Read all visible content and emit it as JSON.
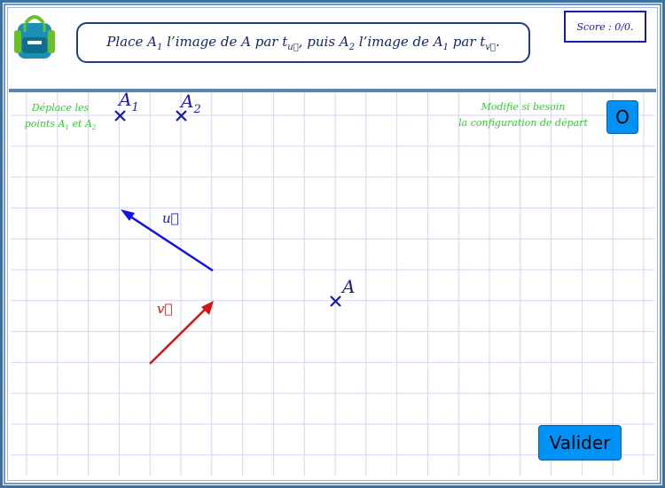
{
  "colors": {
    "border": "#3e6f9e",
    "grid": "#d5d5f7",
    "point": "#1a1aa6",
    "vector_u": "#1010ee",
    "vector_v": "#dd1111",
    "button": "#0093f5",
    "note": "#33cc33"
  },
  "header": {
    "logo_icon": "backpack-icon",
    "instruction": {
      "p1": "Place A",
      "s1": "1",
      "p2": " l’image de A par t",
      "s2": "u⃗",
      "p3": ", puis A",
      "s3": "2",
      "p4": " l’image de A",
      "s4": "1",
      "p5": " par t",
      "s5": "v⃗",
      "p6": "."
    },
    "score_text": "Score : 0/0."
  },
  "board": {
    "note_left": {
      "line1": "Déplace les",
      "line2a": "points A",
      "line2s1": "1",
      "line2b": " et A",
      "line2s2": "2"
    },
    "note_right": {
      "line1": "Modifie si besoin",
      "line2": "la configuration de départ"
    },
    "reset_button_label": "O",
    "submit_button_label": "Valider",
    "points": {
      "A": "A",
      "A1": "A",
      "A1_sub": "1",
      "A2": "A",
      "A2_sub": "2"
    },
    "vectors": {
      "u": "u⃗",
      "v": "v⃗"
    }
  }
}
